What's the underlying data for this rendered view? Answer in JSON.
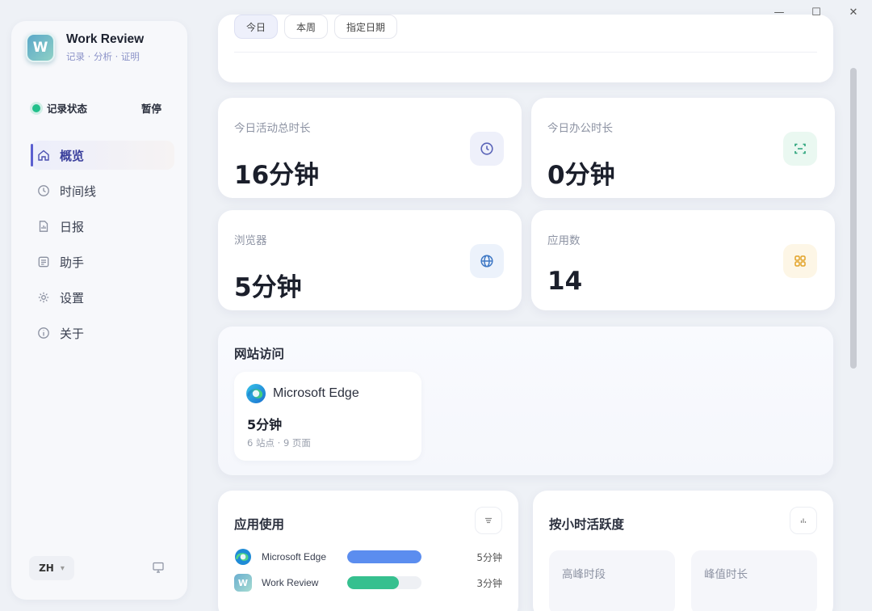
{
  "window": {
    "minimize": "—",
    "maximize": "☐",
    "close": "✕"
  },
  "brand": {
    "logo_letter": "W",
    "title": "Work Review",
    "subtitle": "记录 · 分析 · 证明"
  },
  "status": {
    "label": "记录状态",
    "action": "暂停",
    "color": "#22c08b"
  },
  "nav": [
    {
      "label": "概览",
      "icon": "home-icon",
      "active": true
    },
    {
      "label": "时间线",
      "icon": "clock-icon"
    },
    {
      "label": "日报",
      "icon": "report-icon"
    },
    {
      "label": "助手",
      "icon": "assistant-icon"
    },
    {
      "label": "设置",
      "icon": "gear-icon"
    },
    {
      "label": "关于",
      "icon": "info-icon"
    }
  ],
  "footer": {
    "lang": "ZH"
  },
  "date_filter": [
    {
      "label": "今日",
      "selected": true
    },
    {
      "label": "本周"
    },
    {
      "label": "指定日期"
    }
  ],
  "stats": [
    {
      "label": "今日活动总时长",
      "value": "16分钟",
      "icon": "clock-icon",
      "color": "#5a64b8"
    },
    {
      "label": "今日办公时长",
      "value": "0分钟",
      "icon": "scan-icon",
      "color": "#2aa37a"
    },
    {
      "label": "浏览器",
      "value": "5分钟",
      "icon": "globe-icon",
      "color": "#3e78c5"
    },
    {
      "label": "应用数",
      "value": "14",
      "icon": "grid-icon",
      "color": "#e2a227"
    }
  ],
  "websites": {
    "title": "网站访问",
    "items": [
      {
        "name": "Microsoft Edge",
        "time": "5分钟",
        "meta": "6 站点 · 9 页面"
      }
    ]
  },
  "apps": {
    "title": "应用使用",
    "items": [
      {
        "name": "Microsoft Edge",
        "time": "5分钟",
        "share": 1.0,
        "color": "#5b8def"
      },
      {
        "name": "Work Review",
        "time": "3分钟",
        "share": 0.7,
        "color": "#36c08f"
      }
    ]
  },
  "hourly": {
    "title": "按小时活跃度",
    "boxes": [
      "高峰时段",
      "峰值时长"
    ]
  }
}
